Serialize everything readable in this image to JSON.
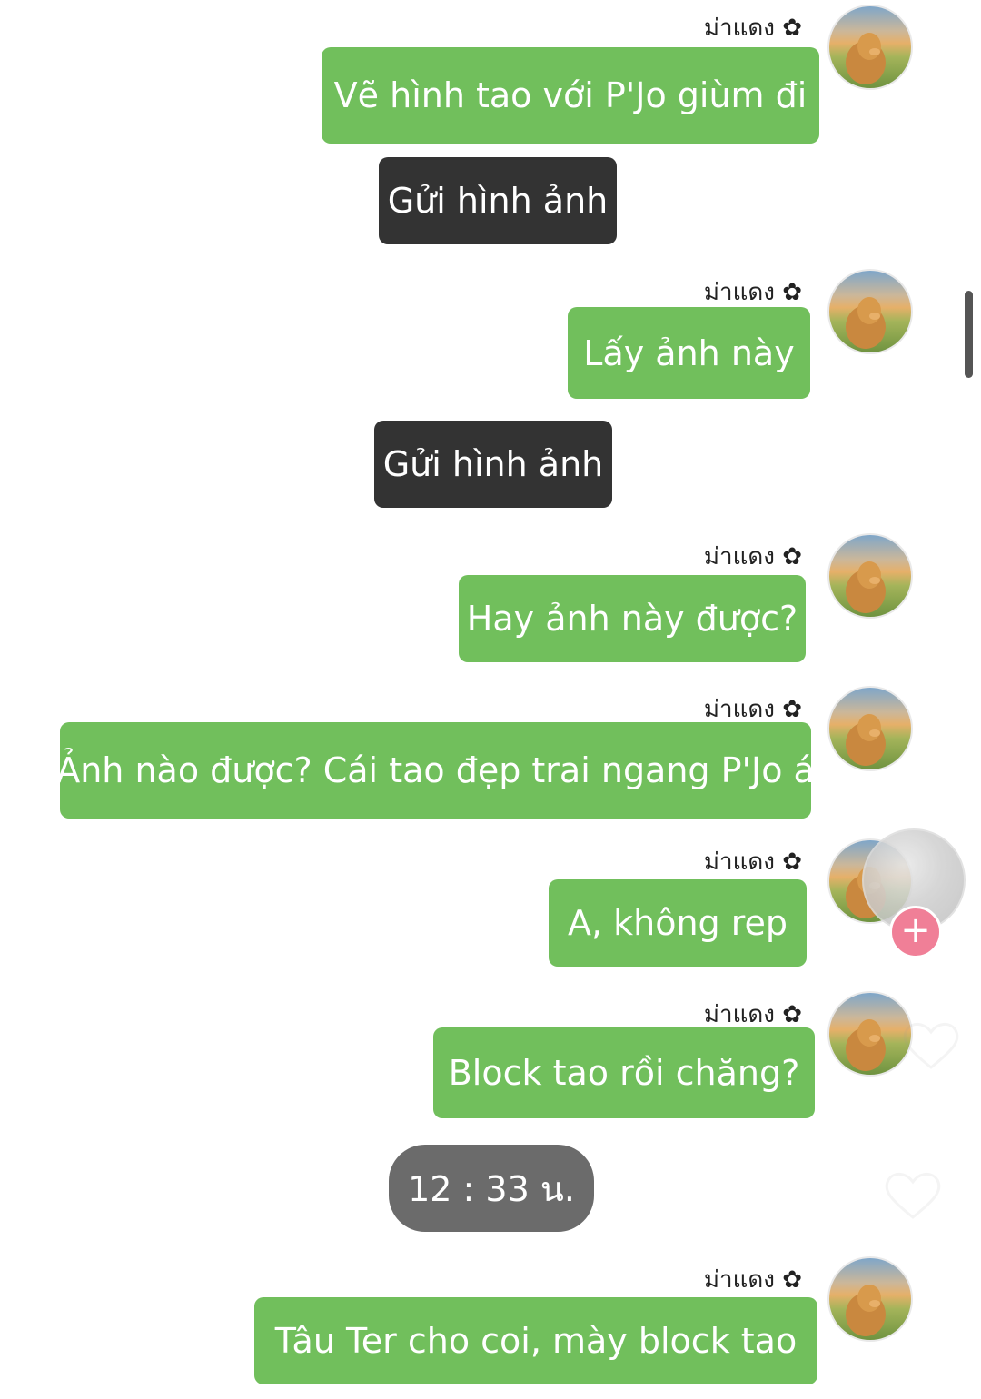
{
  "sender_name": "ม่าแดง ✿",
  "colors": {
    "outgoing_bubble": "#71bf5c",
    "system_bubble": "#333333",
    "time_pill": "#6b6b6b",
    "add_button": "#f07f97"
  },
  "messages": [
    {
      "type": "outgoing",
      "sender": "ม่าแดง ✿",
      "text": "Vẽ hình tao với P'Jo giùm đi"
    },
    {
      "type": "system",
      "text": "Gửi hình ảnh"
    },
    {
      "type": "outgoing",
      "sender": "ม่าแดง ✿",
      "text": "Lấy ảnh này"
    },
    {
      "type": "system",
      "text": "Gửi hình ảnh"
    },
    {
      "type": "outgoing",
      "sender": "ม่าแดง ✿",
      "text": "Hay ảnh này được?"
    },
    {
      "type": "outgoing",
      "sender": "ม่าแดง ✿",
      "text": "Ảnh nào được? Cái tao đẹp trai ngang P'Jo á"
    },
    {
      "type": "outgoing",
      "sender": "ม่าแดง ✿",
      "text": "A, không rep"
    },
    {
      "type": "outgoing",
      "sender": "ม่าแดง ✿",
      "text": "Block tao rồi chăng?"
    },
    {
      "type": "time",
      "text": "12 : 33 น."
    },
    {
      "type": "outgoing",
      "sender": "ม่าแดง ✿",
      "text": "Tâu Ter cho coi, mày block tao"
    }
  ],
  "icons": {
    "avatar": "dog-avatar",
    "float": "floating-profile-avatar",
    "add": "plus-icon"
  }
}
